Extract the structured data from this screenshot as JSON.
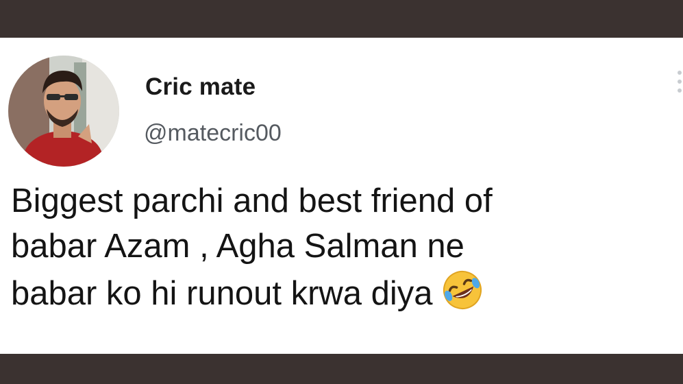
{
  "tweet": {
    "display_name": "Cric mate",
    "handle": "@matecric00",
    "text_lines": [
      "Biggest parchi and best friend of",
      "babar Azam , Agha Salman ne",
      "babar ko hi runout krwa diya"
    ],
    "emoji": "rolling-on-floor-laughing-emoji"
  },
  "colors": {
    "frame": "#3b3230",
    "card": "#ffffff",
    "name": "#1a1a1a",
    "handle": "#555a60",
    "text": "#141414"
  }
}
